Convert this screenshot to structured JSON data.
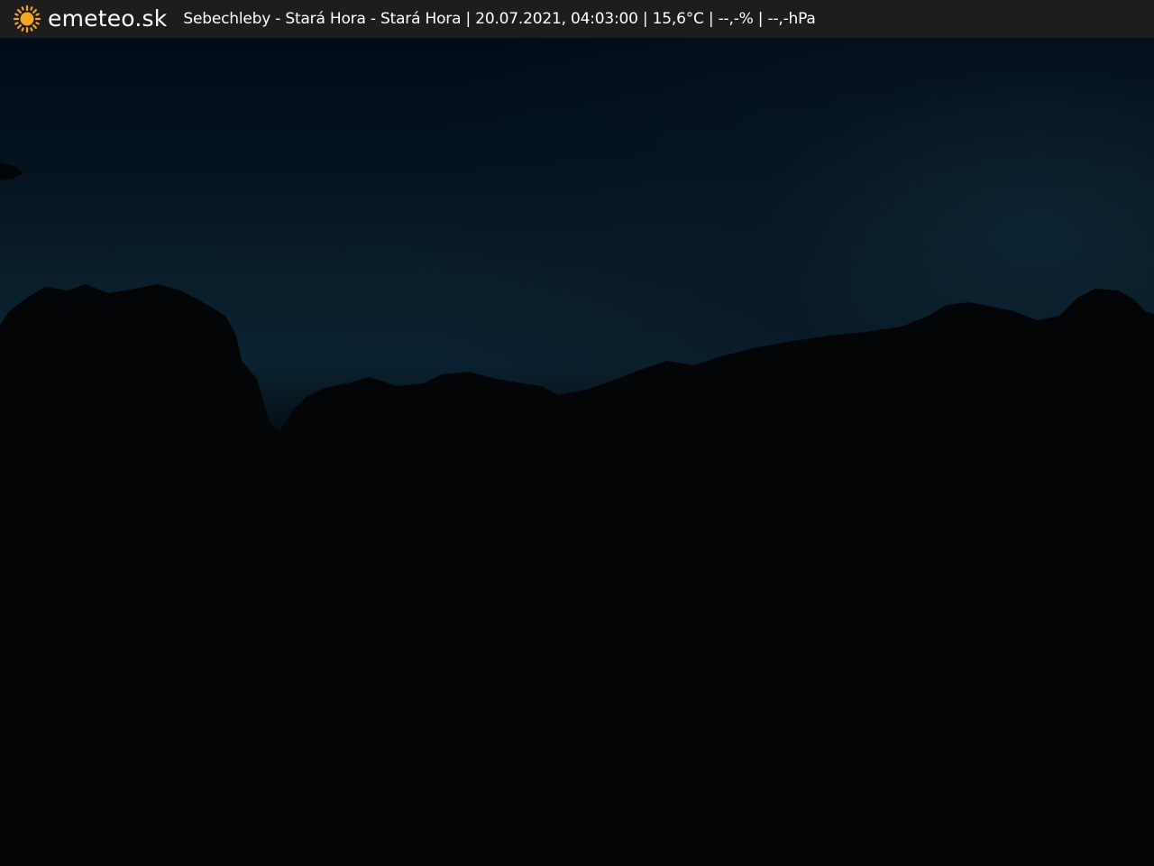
{
  "header": {
    "brand": "emeteo.sk",
    "logo_icon": "sun-icon",
    "caption": "Sebechleby - Stará Hora - Stará Hora | 20.07.2021, 04:03:00 | 15,6°C | --,-% | --,-hPa",
    "background_color": "#1d1d1d",
    "text_color": "#ffffff",
    "accent_color": "#f5a623"
  },
  "scene": {
    "sky_color": "#0a1f2c",
    "ground_color": "#020304"
  }
}
